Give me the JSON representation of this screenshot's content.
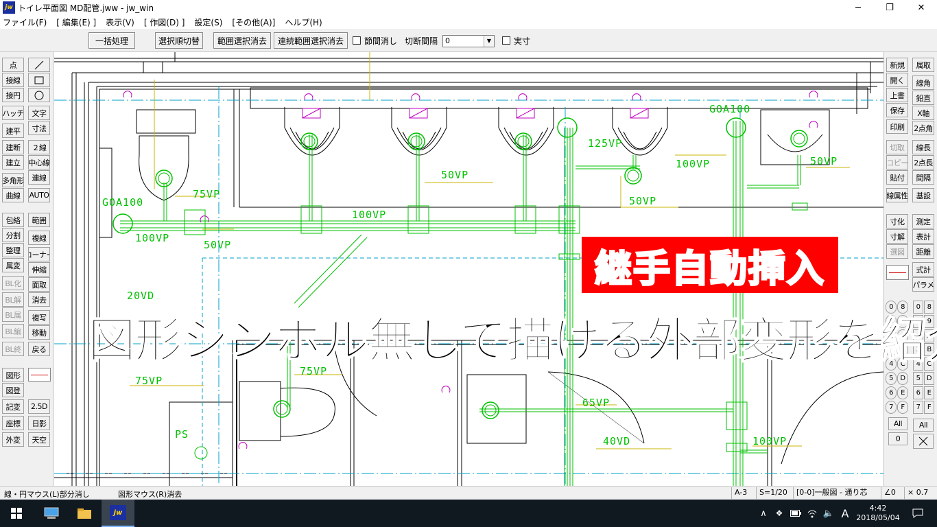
{
  "window": {
    "title": "トイレ平面図 MD配管.jww - jw_win",
    "app_icon": "jw",
    "minimize": "─",
    "maximize": "❐",
    "close": "✕"
  },
  "menu": [
    "ファイル(F)",
    "[ 編集(E) ]",
    "表示(V)",
    "[ 作図(D) ]",
    "設定(S)",
    "[その他(A)]",
    "ヘルプ(H)"
  ],
  "toolbar": {
    "batch": "一括処理",
    "select_order": "選択順切替",
    "range_clear": "範囲選択消去",
    "cont_range_clear": "連続範囲選択消去",
    "node_clear": "節間消し",
    "cut_interval": "切断間隔",
    "cut_value": "0",
    "actual": "実寸"
  },
  "left_panel": {
    "col1": [
      "点",
      "接線",
      "接円",
      "ハッチ",
      "建平",
      "建断",
      "建立",
      "多角形",
      "曲線",
      "包絡",
      "分割",
      "整理",
      "属変",
      "BL化",
      "BL解",
      "BL属",
      "BL編",
      "BL終",
      "図形",
      "図登",
      "記変",
      "座標",
      "外変"
    ],
    "col2_icons": [
      "line-tool-icon",
      "rect-tool-icon",
      "circle-tool-icon"
    ],
    "col2": [
      "文字",
      "寸法",
      "２線",
      "中心線",
      "連線",
      "AUTO",
      "範囲",
      "複線",
      "コーナー",
      "伸縮",
      "面取",
      "消去",
      "複写",
      "移動",
      "戻る",
      "2.5D",
      "日影",
      "天空"
    ]
  },
  "right_panel": {
    "col1": [
      "新規",
      "開く",
      "上書",
      "保存",
      "印刷",
      "切取",
      "コピー",
      "貼付",
      "線属性",
      "寸化",
      "寸解",
      "選図"
    ],
    "col2": [
      "属取",
      "線角",
      "鉛直",
      "X軸",
      "2点角",
      "線長",
      "2点長",
      "間隔",
      "基設",
      "測定",
      "表計",
      "距離",
      "式計",
      "パラメ"
    ],
    "layer_groups_left": [
      "0",
      "1",
      "2",
      "3",
      "4",
      "5",
      "6",
      "7"
    ],
    "layer_groups_left2": [
      "8",
      "9",
      "A",
      "B",
      "C",
      "D",
      "E",
      "F"
    ],
    "layers_right": [
      "0",
      "1",
      "2",
      "3",
      "4",
      "5",
      "6",
      "7"
    ],
    "layers_right2": [
      "8",
      "9",
      "A",
      "B",
      "C",
      "D",
      "E",
      "F"
    ],
    "all": "All",
    "zero": "0"
  },
  "drawing_labels": [
    {
      "text": "GOA100"
    },
    {
      "text": "75VP"
    },
    {
      "text": "100VP"
    },
    {
      "text": "50VP"
    },
    {
      "text": "50VP"
    },
    {
      "text": "100VP"
    },
    {
      "text": "125VP"
    },
    {
      "text": "50VP"
    },
    {
      "text": "100VP"
    },
    {
      "text": "GOA100"
    },
    {
      "text": "50VP"
    },
    {
      "text": "20VD"
    },
    {
      "text": "75VP"
    },
    {
      "text": "75VP"
    },
    {
      "text": "PS"
    },
    {
      "text": "65VP"
    },
    {
      "text": "40VD"
    },
    {
      "text": "100VP"
    }
  ],
  "overlay": {
    "red_banner": "継手自動挿入",
    "caption": "図形シンボル無しで描ける外部変形を紹介"
  },
  "status": {
    "left1": "線・円マウス(L)部分消し",
    "left2": "図形マウス(R)消去",
    "paper": "A-3",
    "scale": "S=1/20",
    "layer": "[0-0]一般図 - 通り芯",
    "angle": "∠0",
    "factor": "× 0.7"
  },
  "taskbar": {
    "time": "4:42",
    "date": "2018/05/04",
    "ime": "A"
  },
  "colors": {
    "pipe": "#00c000",
    "dim": "#c8b400",
    "grid": "#00a0c8",
    "wall": "#000000",
    "fixture": "#c000c0",
    "banner": "#ff0000"
  }
}
